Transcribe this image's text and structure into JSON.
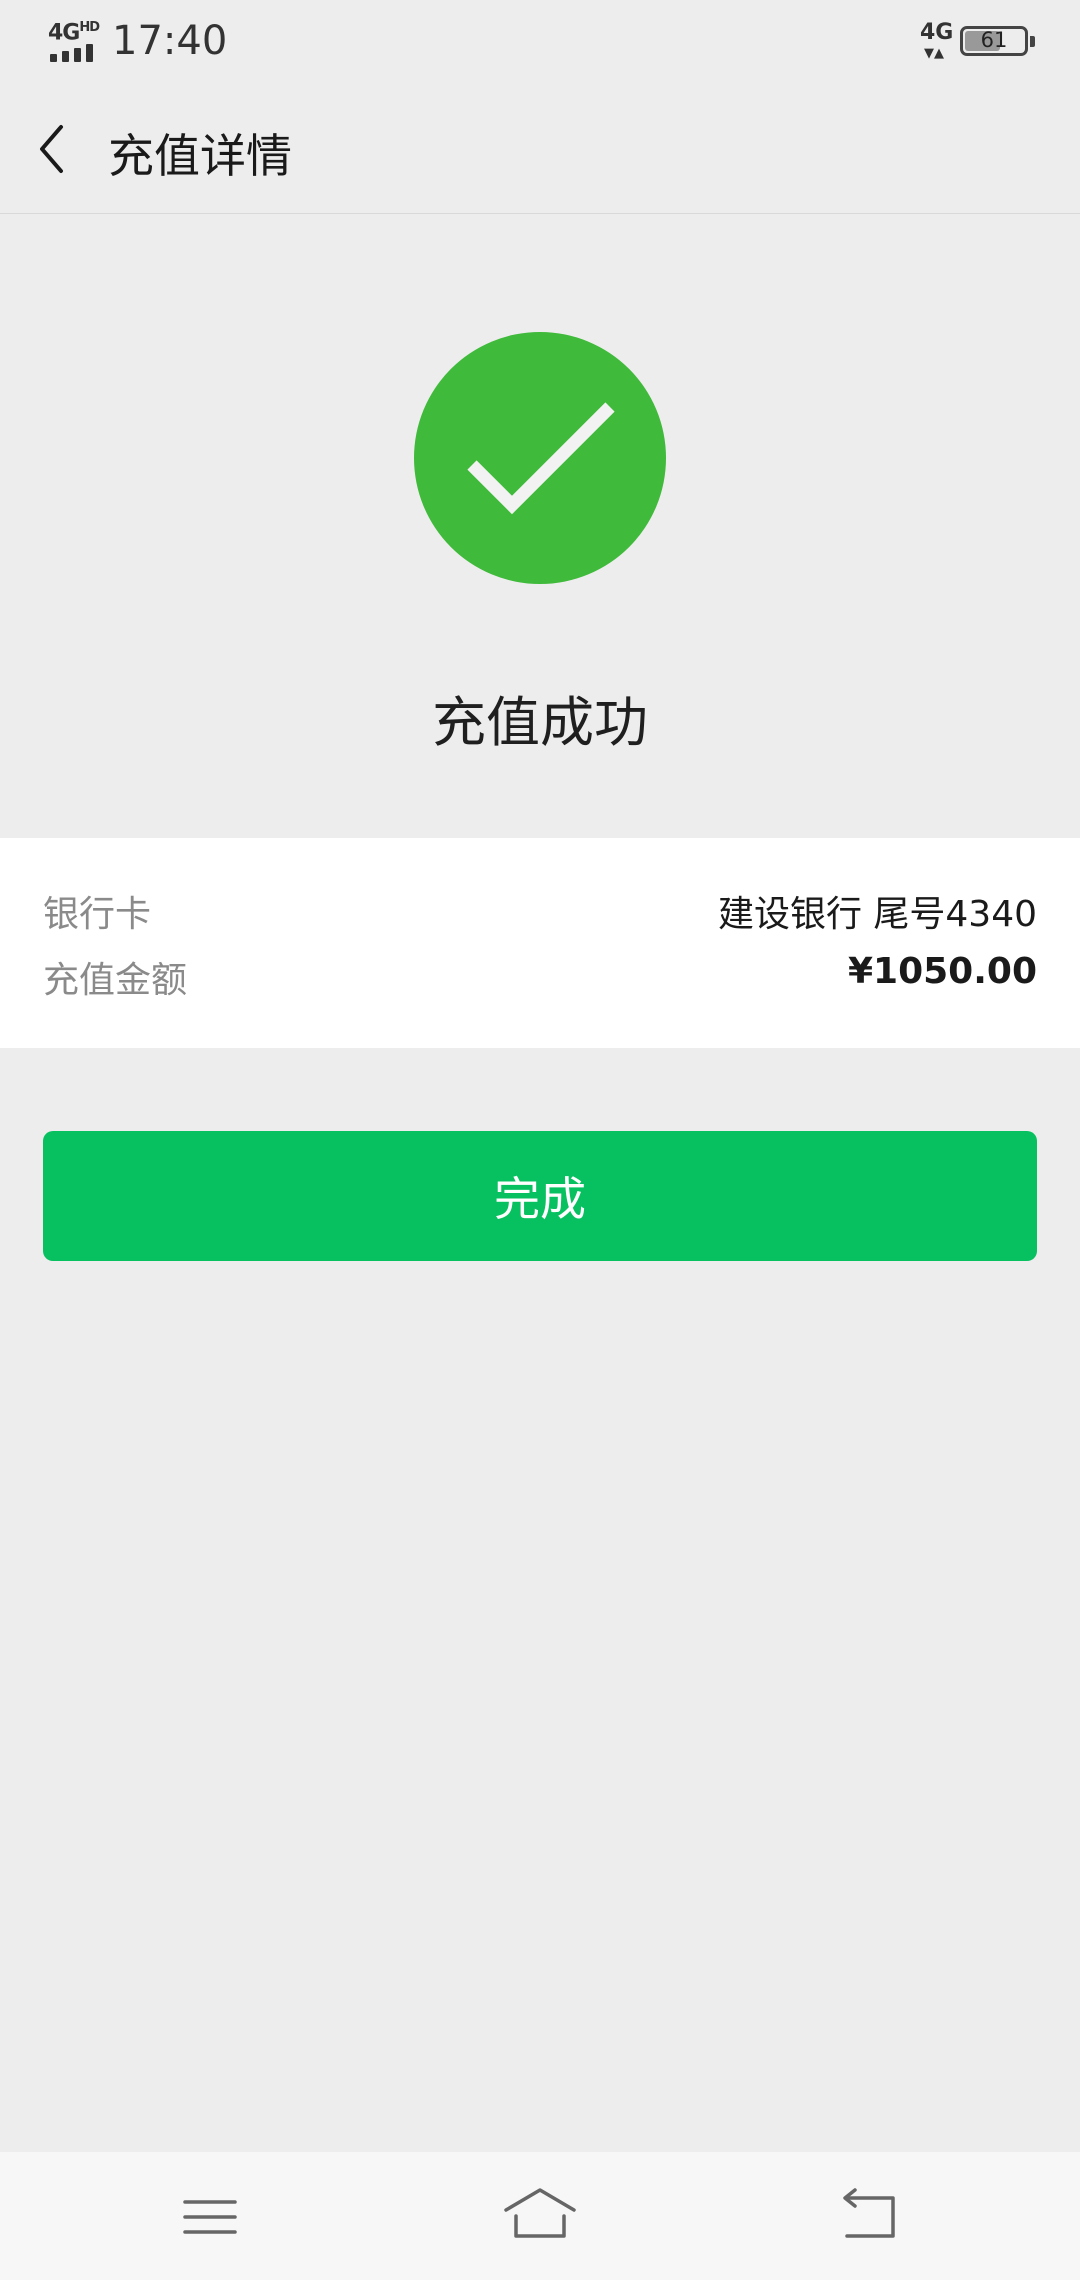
{
  "status_bar": {
    "network_left": "4G",
    "network_left_sup": "HD",
    "time": "17:40",
    "network_right": "4G",
    "battery_level": "61",
    "battery_fraction": 0.61
  },
  "nav": {
    "title": "充值详情"
  },
  "result": {
    "title": "充值成功",
    "accent_color": "#3fba3a"
  },
  "details": {
    "rows": [
      {
        "label": "银行卡",
        "value": "建设银行 尾号4340"
      },
      {
        "label": "充值金额",
        "value": "¥1050.00"
      }
    ]
  },
  "actions": {
    "done_label": "完成",
    "button_color": "#07c160"
  },
  "system_nav": {
    "icons": [
      "menu-icon",
      "home-icon",
      "back-icon"
    ]
  }
}
